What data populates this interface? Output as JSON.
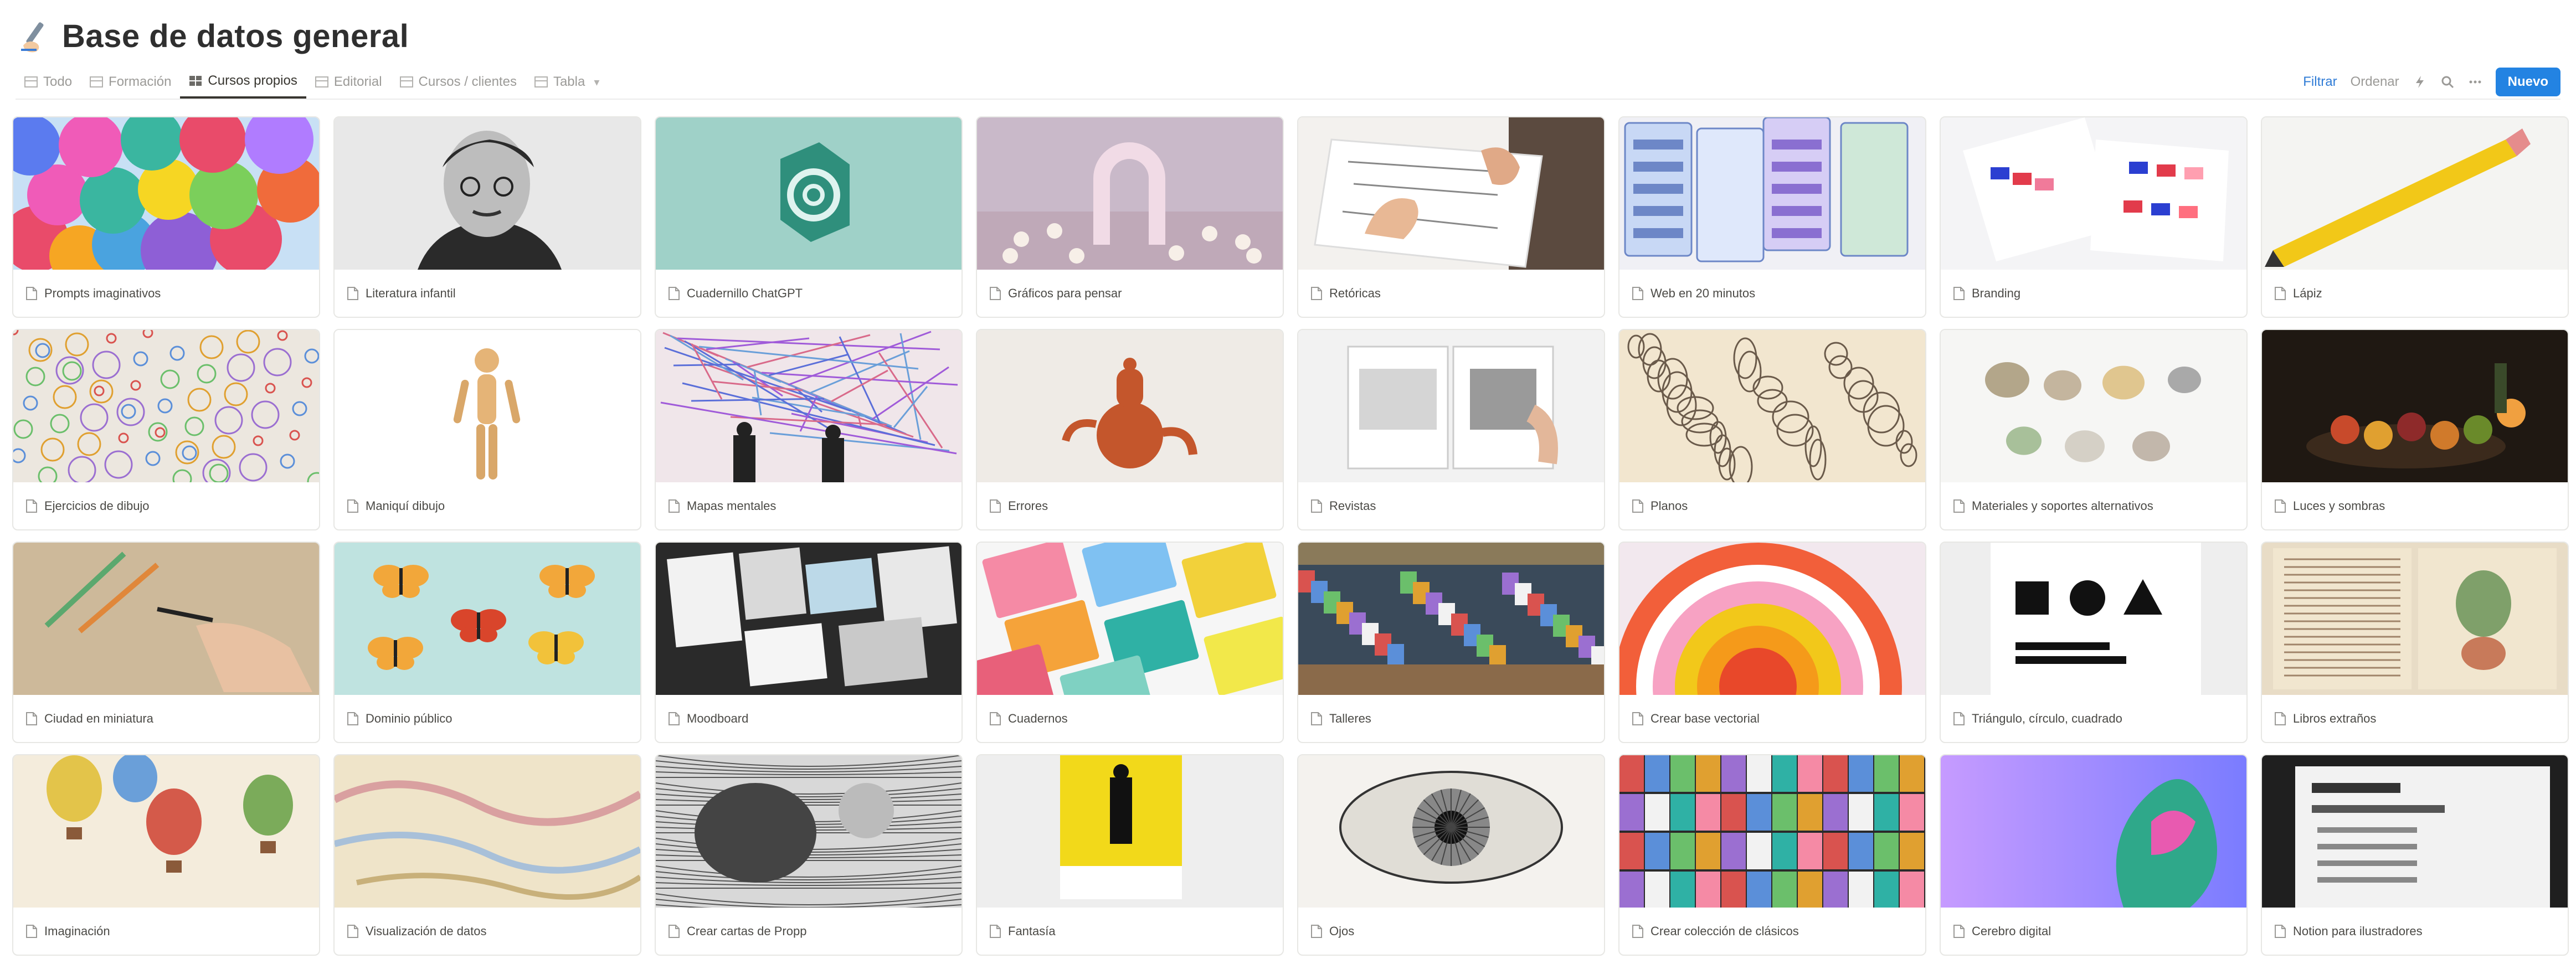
{
  "header": {
    "title": "Base de datos general",
    "icon": "writing-hand-icon"
  },
  "tabs": [
    {
      "label": "Todo"
    },
    {
      "label": "Formación"
    },
    {
      "label": "Cursos propios",
      "active": true
    },
    {
      "label": "Editorial"
    },
    {
      "label": "Cursos / clientes"
    },
    {
      "label": "Tabla"
    }
  ],
  "toolbar": {
    "filter": "Filtrar",
    "sort": "Ordenar",
    "new": "Nuevo"
  },
  "colors": {
    "accent": "#2383e2",
    "link": "#2e7bd6"
  },
  "gallery": {
    "cards": [
      {
        "label": "Prompts imaginativos",
        "image": "colorful-balloons"
      },
      {
        "label": "Literatura infantil",
        "image": "bw-portrait"
      },
      {
        "label": "Cuadernillo ChatGPT",
        "image": "openai-logo"
      },
      {
        "label": "Gráficos para pensar",
        "image": "pastel-arch"
      },
      {
        "label": "Retóricas",
        "image": "hands-sketching"
      },
      {
        "label": "Web en 20 minutos",
        "image": "web-wireframes"
      },
      {
        "label": "Branding",
        "image": "color-swatches"
      },
      {
        "label": "Lápiz",
        "image": "yellow-pencil"
      },
      {
        "label": "Ejercicios de dibujo",
        "image": "doodle-wall"
      },
      {
        "label": "Maniquí dibujo",
        "image": "wooden-mannequin"
      },
      {
        "label": "Mapas mentales",
        "image": "line-art-wall"
      },
      {
        "label": "Errores",
        "image": "clay-teapot"
      },
      {
        "label": "Revistas",
        "image": "magazine"
      },
      {
        "label": "Planos",
        "image": "sketch-drawing"
      },
      {
        "label": "Materiales y soportes alternativos",
        "image": "minerals"
      },
      {
        "label": "Luces y sombras",
        "image": "still-life"
      },
      {
        "label": "Ciudad en miniatura",
        "image": "hand-drawing"
      },
      {
        "label": "Dominio público",
        "image": "butterflies"
      },
      {
        "label": "Moodboard",
        "image": "moodboard"
      },
      {
        "label": "Cuadernos",
        "image": "notebook-patterns"
      },
      {
        "label": "Talleres",
        "image": "workshop-room"
      },
      {
        "label": "Crear base vectorial",
        "image": "concentric-rainbow"
      },
      {
        "label": "Triángulo, círculo, cuadrado",
        "image": "munari-book"
      },
      {
        "label": "Libros extraños",
        "image": "old-manuscript"
      },
      {
        "label": "Imaginación",
        "image": "balloon-illustration"
      },
      {
        "label": "Visualización de datos",
        "image": "old-map"
      },
      {
        "label": "Crear cartas de Propp",
        "image": "engraving"
      },
      {
        "label": "Fantasía",
        "image": "yellow-book"
      },
      {
        "label": "Ojos",
        "image": "eye-engraving"
      },
      {
        "label": "Crear colección de clásicos",
        "image": "book-spines"
      },
      {
        "label": "Cerebro digital",
        "image": "gradient-sculpture"
      },
      {
        "label": "Notion para ilustradores",
        "image": "notion-screen"
      }
    ]
  }
}
